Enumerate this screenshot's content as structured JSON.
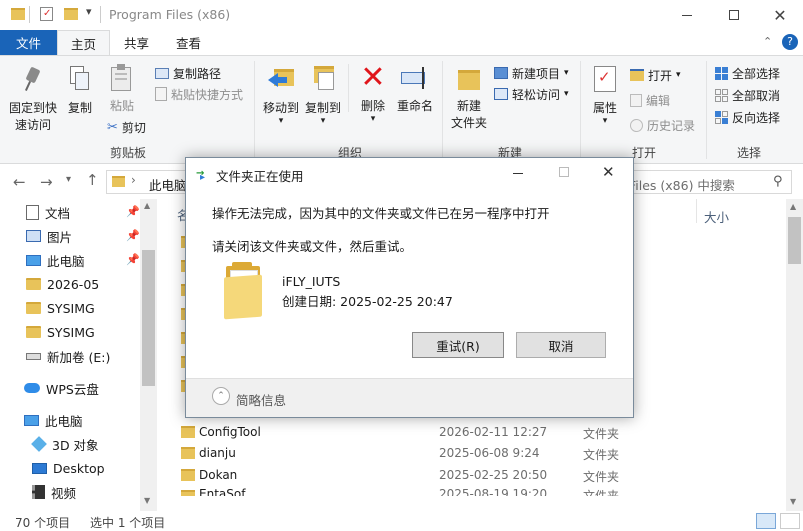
{
  "window": {
    "title": "Program Files (x86)",
    "qat_dropdown": "▾"
  },
  "tabs": [
    "文件",
    "主页",
    "共享",
    "查看"
  ],
  "ribbon": {
    "clipboard": {
      "pin": "固定到快\n速访问",
      "copy": "复制",
      "paste": "粘贴",
      "copy_path": "复制路径",
      "paste_shortcut": "粘贴快捷方式",
      "cut": "剪切",
      "group": "剪贴板"
    },
    "organize": {
      "move_to": "移动到",
      "copy_to": "复制到",
      "delete": "删除",
      "rename": "重命名",
      "group": "组织"
    },
    "new": {
      "new_folder": "新建\n文件夹",
      "new_item": "新建项目",
      "easy_access": "轻松访问",
      "group": "新建"
    },
    "open": {
      "properties": "属性",
      "open": "打开",
      "edit": "编辑",
      "history": "历史记录",
      "group": "打开"
    },
    "select": {
      "select_all": "全部选择",
      "select_none": "全部取消",
      "invert": "反向选择",
      "group": "选择"
    }
  },
  "address": {
    "crumb": "此电脑",
    "search_placeholder": "Files (x86) 中搜索"
  },
  "nav": [
    {
      "label": "文档",
      "icon": "document-icon",
      "pinned": true
    },
    {
      "label": "图片",
      "icon": "picture-icon",
      "pinned": true
    },
    {
      "label": "此电脑",
      "icon": "computer-icon",
      "pinned": true
    },
    {
      "label": "2026-05",
      "icon": "folder-icon",
      "pinned": false
    },
    {
      "label": "SYSIMG",
      "icon": "folder-icon",
      "pinned": false
    },
    {
      "label": "SYSIMG",
      "icon": "folder-icon",
      "pinned": false
    },
    {
      "label": "新加卷 (E:)",
      "icon": "drive-icon",
      "pinned": false
    },
    {
      "label": "WPS云盘",
      "icon": "cloud-icon",
      "pinned": false
    },
    {
      "label": "此电脑",
      "icon": "computer-icon",
      "pinned": false
    },
    {
      "label": "3D 对象",
      "icon": "cube-icon",
      "pinned": false
    },
    {
      "label": "Desktop",
      "icon": "desktop-icon",
      "pinned": false
    },
    {
      "label": "视频",
      "icon": "video-icon",
      "pinned": false
    }
  ],
  "columns": {
    "name": "名",
    "size": "大小"
  },
  "files": [
    {
      "name": "ConfigTool",
      "date": "2026-02-11 12:27",
      "type": "文件夹"
    },
    {
      "name": "dianju",
      "date": "2025-06-08 9:24",
      "type": "文件夹"
    },
    {
      "name": "Dokan",
      "date": "2025-02-25 20:50",
      "type": "文件夹"
    },
    {
      "name": "EntaSof",
      "date": "2025-08-19 19:20",
      "type": "文件夹"
    }
  ],
  "status": {
    "count": "70 个项目",
    "selected": "选中 1 个项目"
  },
  "dialog": {
    "title": "文件夹正在使用",
    "message": "操作无法完成，因为其中的文件夹或文件已在另一程序中打开",
    "hint": "请关闭该文件夹或文件，然后重试。",
    "file_name": "iFLY_IUTS",
    "created": "创建日期: 2025-02-25 20:47",
    "retry": "重试(R)",
    "cancel": "取消",
    "details": "简略信息"
  }
}
